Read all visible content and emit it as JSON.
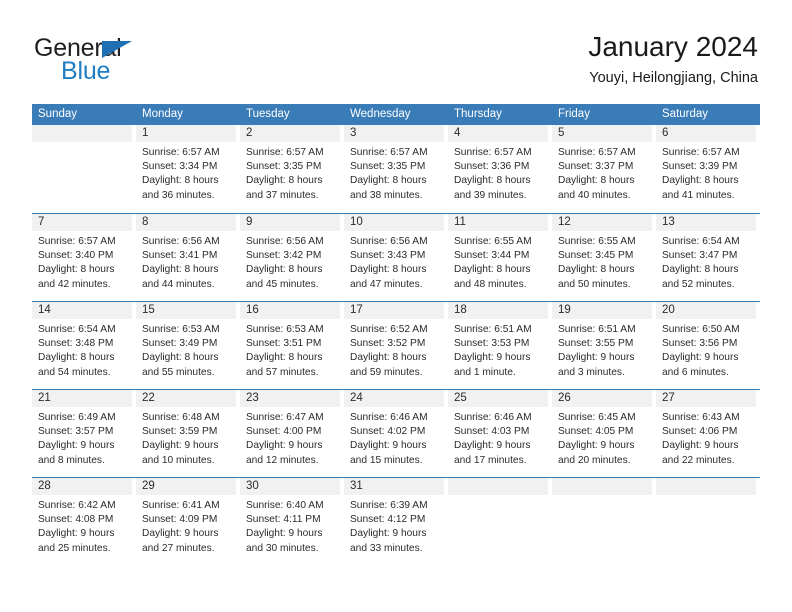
{
  "brand": {
    "name_part1": "General",
    "name_part2": "Blue",
    "triangle_icon": "triangle-icon",
    "colors": {
      "dark": "#231f20",
      "blue": "#1f7ec4",
      "header_blue": "#3a7cb8"
    }
  },
  "header": {
    "title": "January 2024",
    "subtitle": "Youyi, Heilongjiang, China"
  },
  "calendar": {
    "weekday_headers": [
      "Sunday",
      "Monday",
      "Tuesday",
      "Wednesday",
      "Thursday",
      "Friday",
      "Saturday"
    ],
    "weeks": [
      [
        {
          "day": "",
          "sunrise": "",
          "sunset": "",
          "daylight1": "",
          "daylight2": ""
        },
        {
          "day": "1",
          "sunrise": "Sunrise: 6:57 AM",
          "sunset": "Sunset: 3:34 PM",
          "daylight1": "Daylight: 8 hours",
          "daylight2": "and 36 minutes."
        },
        {
          "day": "2",
          "sunrise": "Sunrise: 6:57 AM",
          "sunset": "Sunset: 3:35 PM",
          "daylight1": "Daylight: 8 hours",
          "daylight2": "and 37 minutes."
        },
        {
          "day": "3",
          "sunrise": "Sunrise: 6:57 AM",
          "sunset": "Sunset: 3:35 PM",
          "daylight1": "Daylight: 8 hours",
          "daylight2": "and 38 minutes."
        },
        {
          "day": "4",
          "sunrise": "Sunrise: 6:57 AM",
          "sunset": "Sunset: 3:36 PM",
          "daylight1": "Daylight: 8 hours",
          "daylight2": "and 39 minutes."
        },
        {
          "day": "5",
          "sunrise": "Sunrise: 6:57 AM",
          "sunset": "Sunset: 3:37 PM",
          "daylight1": "Daylight: 8 hours",
          "daylight2": "and 40 minutes."
        },
        {
          "day": "6",
          "sunrise": "Sunrise: 6:57 AM",
          "sunset": "Sunset: 3:39 PM",
          "daylight1": "Daylight: 8 hours",
          "daylight2": "and 41 minutes."
        }
      ],
      [
        {
          "day": "7",
          "sunrise": "Sunrise: 6:57 AM",
          "sunset": "Sunset: 3:40 PM",
          "daylight1": "Daylight: 8 hours",
          "daylight2": "and 42 minutes."
        },
        {
          "day": "8",
          "sunrise": "Sunrise: 6:56 AM",
          "sunset": "Sunset: 3:41 PM",
          "daylight1": "Daylight: 8 hours",
          "daylight2": "and 44 minutes."
        },
        {
          "day": "9",
          "sunrise": "Sunrise: 6:56 AM",
          "sunset": "Sunset: 3:42 PM",
          "daylight1": "Daylight: 8 hours",
          "daylight2": "and 45 minutes."
        },
        {
          "day": "10",
          "sunrise": "Sunrise: 6:56 AM",
          "sunset": "Sunset: 3:43 PM",
          "daylight1": "Daylight: 8 hours",
          "daylight2": "and 47 minutes."
        },
        {
          "day": "11",
          "sunrise": "Sunrise: 6:55 AM",
          "sunset": "Sunset: 3:44 PM",
          "daylight1": "Daylight: 8 hours",
          "daylight2": "and 48 minutes."
        },
        {
          "day": "12",
          "sunrise": "Sunrise: 6:55 AM",
          "sunset": "Sunset: 3:45 PM",
          "daylight1": "Daylight: 8 hours",
          "daylight2": "and 50 minutes."
        },
        {
          "day": "13",
          "sunrise": "Sunrise: 6:54 AM",
          "sunset": "Sunset: 3:47 PM",
          "daylight1": "Daylight: 8 hours",
          "daylight2": "and 52 minutes."
        }
      ],
      [
        {
          "day": "14",
          "sunrise": "Sunrise: 6:54 AM",
          "sunset": "Sunset: 3:48 PM",
          "daylight1": "Daylight: 8 hours",
          "daylight2": "and 54 minutes."
        },
        {
          "day": "15",
          "sunrise": "Sunrise: 6:53 AM",
          "sunset": "Sunset: 3:49 PM",
          "daylight1": "Daylight: 8 hours",
          "daylight2": "and 55 minutes."
        },
        {
          "day": "16",
          "sunrise": "Sunrise: 6:53 AM",
          "sunset": "Sunset: 3:51 PM",
          "daylight1": "Daylight: 8 hours",
          "daylight2": "and 57 minutes."
        },
        {
          "day": "17",
          "sunrise": "Sunrise: 6:52 AM",
          "sunset": "Sunset: 3:52 PM",
          "daylight1": "Daylight: 8 hours",
          "daylight2": "and 59 minutes."
        },
        {
          "day": "18",
          "sunrise": "Sunrise: 6:51 AM",
          "sunset": "Sunset: 3:53 PM",
          "daylight1": "Daylight: 9 hours",
          "daylight2": "and 1 minute."
        },
        {
          "day": "19",
          "sunrise": "Sunrise: 6:51 AM",
          "sunset": "Sunset: 3:55 PM",
          "daylight1": "Daylight: 9 hours",
          "daylight2": "and 3 minutes."
        },
        {
          "day": "20",
          "sunrise": "Sunrise: 6:50 AM",
          "sunset": "Sunset: 3:56 PM",
          "daylight1": "Daylight: 9 hours",
          "daylight2": "and 6 minutes."
        }
      ],
      [
        {
          "day": "21",
          "sunrise": "Sunrise: 6:49 AM",
          "sunset": "Sunset: 3:57 PM",
          "daylight1": "Daylight: 9 hours",
          "daylight2": "and 8 minutes."
        },
        {
          "day": "22",
          "sunrise": "Sunrise: 6:48 AM",
          "sunset": "Sunset: 3:59 PM",
          "daylight1": "Daylight: 9 hours",
          "daylight2": "and 10 minutes."
        },
        {
          "day": "23",
          "sunrise": "Sunrise: 6:47 AM",
          "sunset": "Sunset: 4:00 PM",
          "daylight1": "Daylight: 9 hours",
          "daylight2": "and 12 minutes."
        },
        {
          "day": "24",
          "sunrise": "Sunrise: 6:46 AM",
          "sunset": "Sunset: 4:02 PM",
          "daylight1": "Daylight: 9 hours",
          "daylight2": "and 15 minutes."
        },
        {
          "day": "25",
          "sunrise": "Sunrise: 6:46 AM",
          "sunset": "Sunset: 4:03 PM",
          "daylight1": "Daylight: 9 hours",
          "daylight2": "and 17 minutes."
        },
        {
          "day": "26",
          "sunrise": "Sunrise: 6:45 AM",
          "sunset": "Sunset: 4:05 PM",
          "daylight1": "Daylight: 9 hours",
          "daylight2": "and 20 minutes."
        },
        {
          "day": "27",
          "sunrise": "Sunrise: 6:43 AM",
          "sunset": "Sunset: 4:06 PM",
          "daylight1": "Daylight: 9 hours",
          "daylight2": "and 22 minutes."
        }
      ],
      [
        {
          "day": "28",
          "sunrise": "Sunrise: 6:42 AM",
          "sunset": "Sunset: 4:08 PM",
          "daylight1": "Daylight: 9 hours",
          "daylight2": "and 25 minutes."
        },
        {
          "day": "29",
          "sunrise": "Sunrise: 6:41 AM",
          "sunset": "Sunset: 4:09 PM",
          "daylight1": "Daylight: 9 hours",
          "daylight2": "and 27 minutes."
        },
        {
          "day": "30",
          "sunrise": "Sunrise: 6:40 AM",
          "sunset": "Sunset: 4:11 PM",
          "daylight1": "Daylight: 9 hours",
          "daylight2": "and 30 minutes."
        },
        {
          "day": "31",
          "sunrise": "Sunrise: 6:39 AM",
          "sunset": "Sunset: 4:12 PM",
          "daylight1": "Daylight: 9 hours",
          "daylight2": "and 33 minutes."
        },
        {
          "day": "",
          "sunrise": "",
          "sunset": "",
          "daylight1": "",
          "daylight2": ""
        },
        {
          "day": "",
          "sunrise": "",
          "sunset": "",
          "daylight1": "",
          "daylight2": ""
        },
        {
          "day": "",
          "sunrise": "",
          "sunset": "",
          "daylight1": "",
          "daylight2": ""
        }
      ]
    ]
  }
}
